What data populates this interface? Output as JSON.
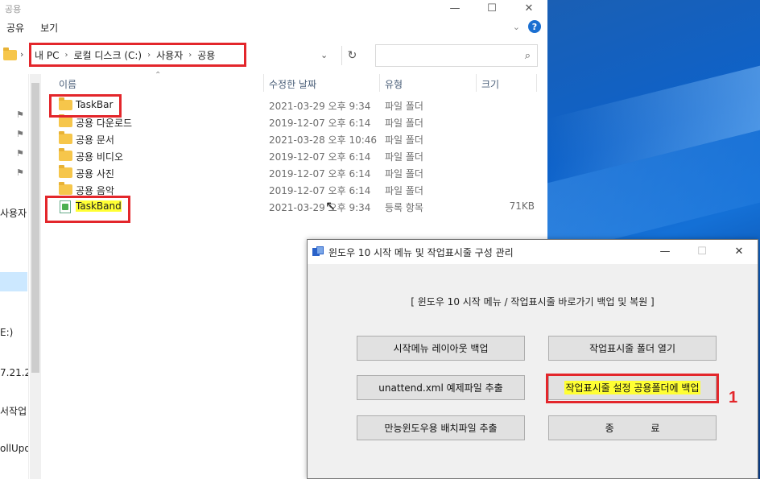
{
  "explorer": {
    "title": "공용",
    "ribbon_tabs": [
      "공유",
      "보기"
    ],
    "breadcrumb": [
      "내 PC",
      "로컬 디스크 (C:)",
      "사용자",
      "공용"
    ],
    "nav_labels": [
      "사용자",
      "E:)",
      "7.21.2",
      "서작업",
      "ollUpda"
    ],
    "columns": {
      "name": "이름",
      "date": "수정한 날짜",
      "type": "유형",
      "size": "크기"
    },
    "files": [
      {
        "name": "TaskBar",
        "date": "2021-03-29 오후 9:34",
        "type": "파일 폴더",
        "size": ""
      },
      {
        "name": "공용 다운로드",
        "date": "2019-12-07 오후 6:14",
        "type": "파일 폴더",
        "size": ""
      },
      {
        "name": "공용 문서",
        "date": "2021-03-28 오후 10:46",
        "type": "파일 폴더",
        "size": ""
      },
      {
        "name": "공용 비디오",
        "date": "2019-12-07 오후 6:14",
        "type": "파일 폴더",
        "size": ""
      },
      {
        "name": "공용 사진",
        "date": "2019-12-07 오후 6:14",
        "type": "파일 폴더",
        "size": ""
      },
      {
        "name": "공용 음악",
        "date": "2019-12-07 오후 6:14",
        "type": "파일 폴더",
        "size": ""
      },
      {
        "name": "TaskBand",
        "date": "2021-03-29 오후 9:34",
        "type": "등록 항목",
        "size": "71KB"
      }
    ]
  },
  "dialog": {
    "title": "윈도우 10 시작 메뉴 및 작업표시줄 구성 관리",
    "heading": "[ 윈도우 10  시작 메뉴 / 작업표시줄 바로가기 백업 및 복원 ]",
    "buttons": {
      "start_layout_backup": "시작메뉴 레이아웃 백업",
      "open_taskbar_folder": "작업표시줄  폴더 열기",
      "unattend_extract": "unattend.xml 예제파일 추출",
      "taskbar_backup_public": "작업표시줄 설정 공용폴더에 백업",
      "batch_extract": "만능윈도우용 배치파일 추출",
      "exit": "종            료"
    }
  },
  "annotation": {
    "step_marker": "1"
  },
  "colors": {
    "highlight_box": "#e3262b",
    "text_highlight": "#ffff33"
  }
}
